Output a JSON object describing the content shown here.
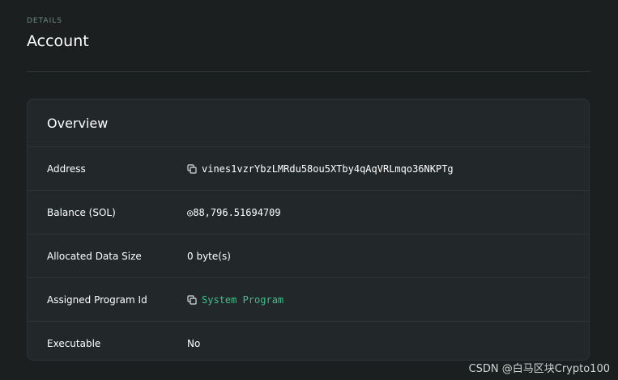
{
  "header": {
    "section_label": "DETAILS",
    "title": "Account"
  },
  "overview": {
    "title": "Overview",
    "rows": [
      {
        "label": "Address",
        "value": "vines1vzrYbzLMRdu58ou5XTby4qAqVRLmqo36NKPTg",
        "icon": "copy-icon"
      },
      {
        "label": "Balance (SOL)",
        "value": "◎88,796.51694709"
      },
      {
        "label": "Allocated Data Size",
        "value": "0 byte(s)"
      },
      {
        "label": "Assigned Program Id",
        "value": "System Program",
        "icon": "copy-icon"
      },
      {
        "label": "Executable",
        "value": "No"
      }
    ]
  },
  "colors": {
    "background": "#1b1f1f",
    "card": "#222829",
    "accent": "#3fbf8b",
    "muted_label": "#6f8b7e"
  },
  "watermark": "CSDN @白马区块Crypto100"
}
